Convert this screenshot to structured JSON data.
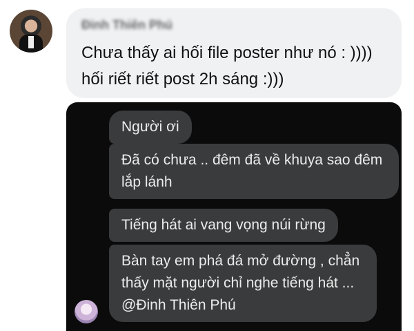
{
  "comment": {
    "author_name": "Đinh Thiên Phú",
    "text": "Chưa thấy ai hối file poster như nó : )))) hối riết riết post 2h sáng :)))"
  },
  "messages": [
    "Người ơi",
    "Đã có chưa .. đêm đã về khuya sao đêm lắp lánh",
    "Tiếng hát ai vang vọng núi rừng",
    "Bàn tay em phá đá mở đường , chẳn thấy mặt người chỉ nghe tiếng hát ... @Đinh Thiên Phú"
  ]
}
